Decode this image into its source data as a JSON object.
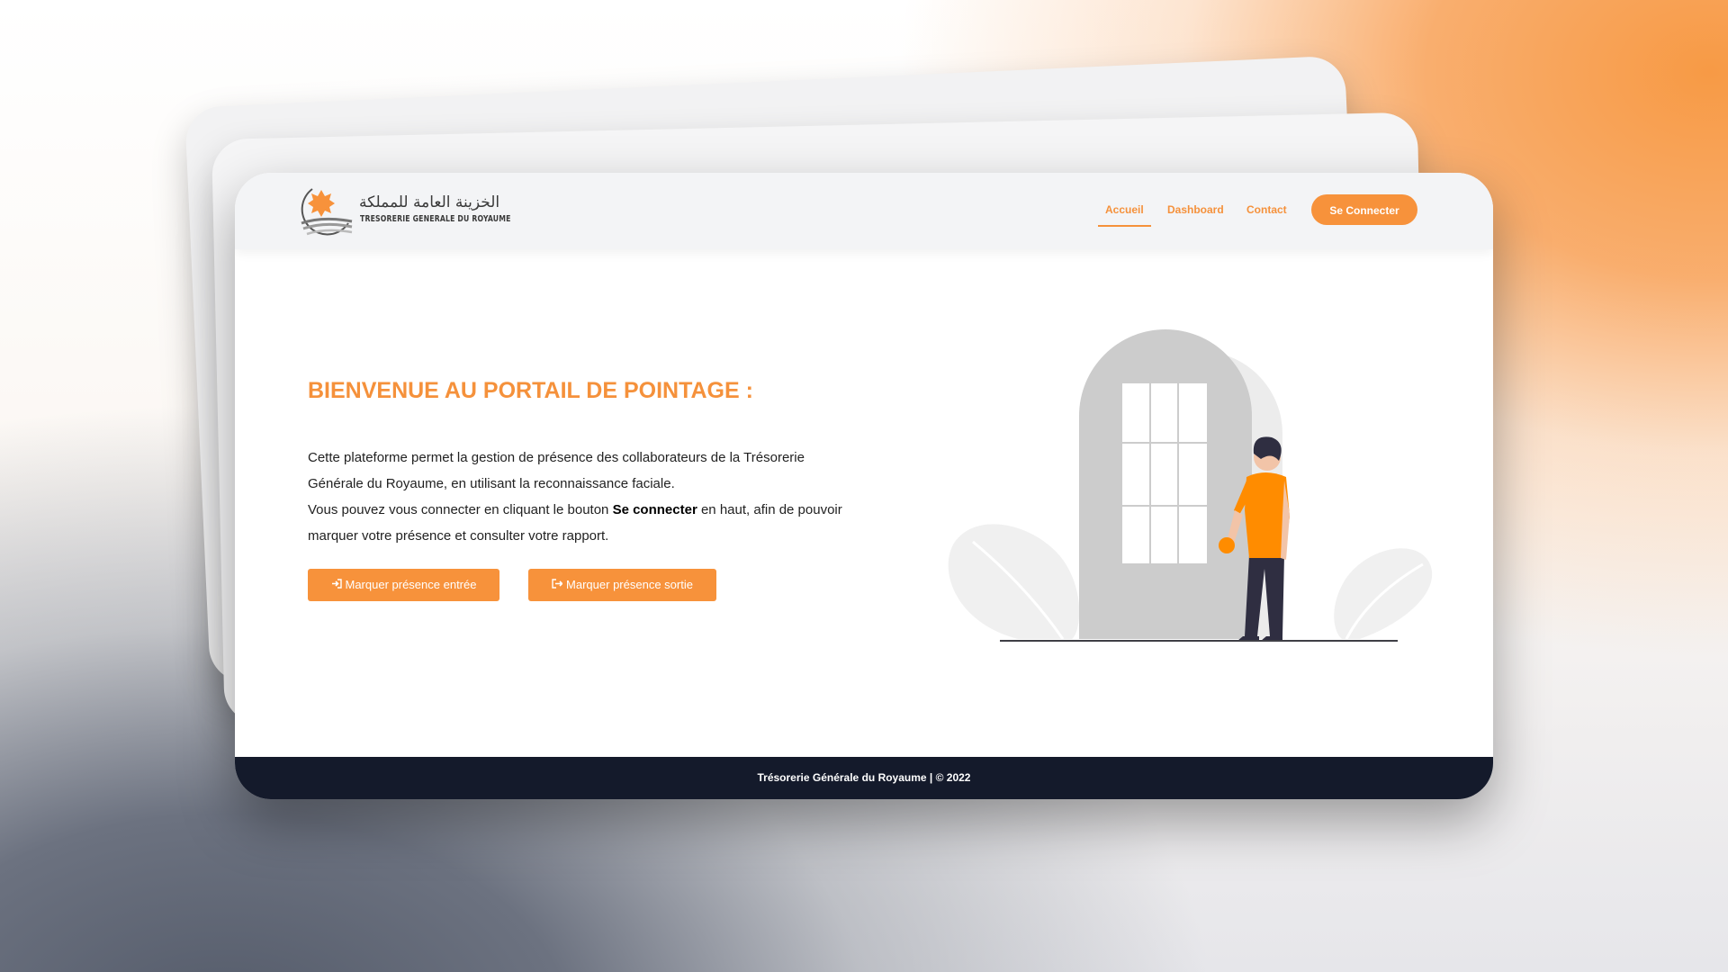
{
  "brand": {
    "name_ar": "الخزينة العامة للمملكة",
    "name_fr": "TRESORERIE GENERALE DU ROYAUME",
    "accent_color": "#f7923b"
  },
  "nav": {
    "items": [
      {
        "label": "Accueil",
        "active": true
      },
      {
        "label": "Dashboard",
        "active": false
      },
      {
        "label": "Contact",
        "active": false
      }
    ],
    "login_label": "Se Connecter"
  },
  "hero": {
    "title": "BIENVENUE AU PORTAIL DE POINTAGE :",
    "para1": "Cette plateforme permet la gestion de présence des collaborateurs de la Trésorerie Générale du Royaume, en utilisant la reconnaissance faciale.",
    "para2_before": "Vous pouvez vous connecter en cliquant le bouton ",
    "para2_bold": "Se connecter",
    "para2_after": " en haut, afin de pouvoir marquer votre présence et consulter votre rapport.",
    "btn_entree": "Marquer présence entrée",
    "btn_sortie": "Marquer présence sortie",
    "icon_entree": "sign-in-icon",
    "icon_sortie": "sign-out-icon"
  },
  "footer": {
    "text": "Trésorerie Générale du Royaume | © 2022",
    "bg_color": "#141a2b"
  }
}
